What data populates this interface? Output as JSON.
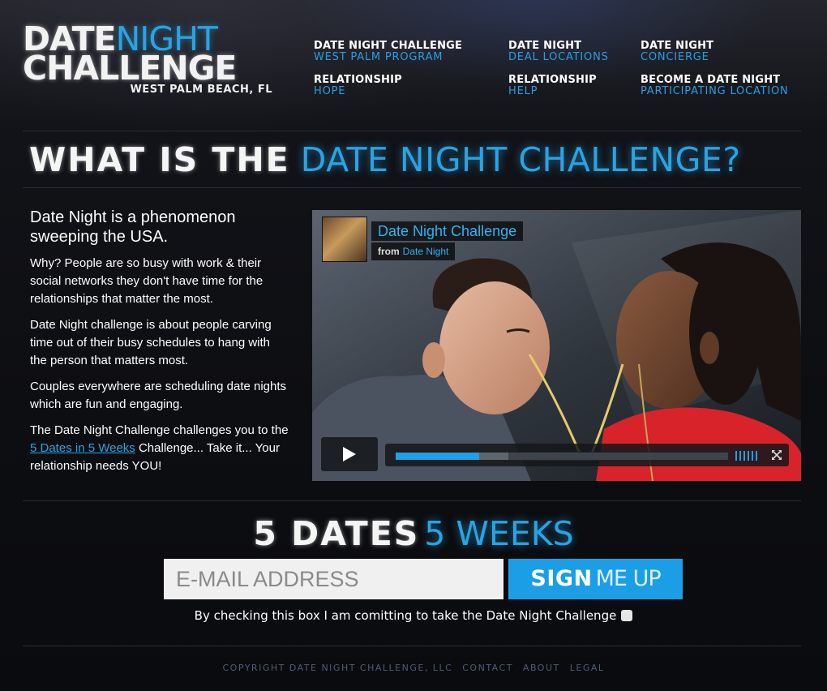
{
  "logo": {
    "line1_a": "DATE",
    "line1_b": "NIGHT",
    "line2": "CHALLENGE",
    "line3": "WEST PALM BEACH, FL"
  },
  "nav": {
    "items": [
      {
        "top": "DATE NIGHT CHALLENGE",
        "bottom": "WEST PALM PROGRAM"
      },
      {
        "top": "DATE NIGHT",
        "bottom": "DEAL LOCATIONS"
      },
      {
        "top": "DATE NIGHT",
        "bottom": "CONCIERGE"
      },
      {
        "top": "RELATIONSHIP",
        "bottom": "HOPE"
      },
      {
        "top": "RELATIONSHIP",
        "bottom": "HELP"
      },
      {
        "top": "BECOME A DATE NIGHT",
        "bottom": "PARTICIPATING LOCATION"
      }
    ]
  },
  "headline": {
    "white": "WHAT IS THE",
    "blue": "DATE NIGHT CHALLENGE?"
  },
  "copy": {
    "lead": "Date Night is a phenomenon sweeping the USA.",
    "p1": "Why? People are so busy with work & their social networks they don't have time for the relationships that matter the most.",
    "p2": "Date Night challenge is about people carving time out of their busy schedules to hang with the person that matters most.",
    "p3": "Couples everywhere are scheduling date nights which are fun and engaging.",
    "p4_a": "The Date Night Challenge challenges you to the ",
    "p4_link": "5 Dates in 5 Weeks",
    "p4_b": " Challenge... Take it... Your relationship needs YOU!"
  },
  "video": {
    "title": "Date Night Challenge",
    "from_label": "from",
    "from_name": "Date Night",
    "progress_played": 0.25,
    "progress_loaded": 0.34
  },
  "signup": {
    "title_white": "5 DATES",
    "title_blue": "5 WEEKS",
    "email_placeholder": "E-MAIL ADDRESS",
    "button_bold": "SIGN",
    "button_light": "ME UP",
    "commit_text": "By checking this box I am comitting to take the Date Night Challenge",
    "commit_checked": false
  },
  "footer": {
    "copyright": "COPYRIGHT DATE NIGHT CHALLENGE, LLC",
    "contact": "CONTACT",
    "about": "ABOUT",
    "legal": "LEGAL"
  },
  "colors": {
    "accent": "#2aa3e3",
    "background": "#0c0d11",
    "button": "#1b9ee6"
  }
}
